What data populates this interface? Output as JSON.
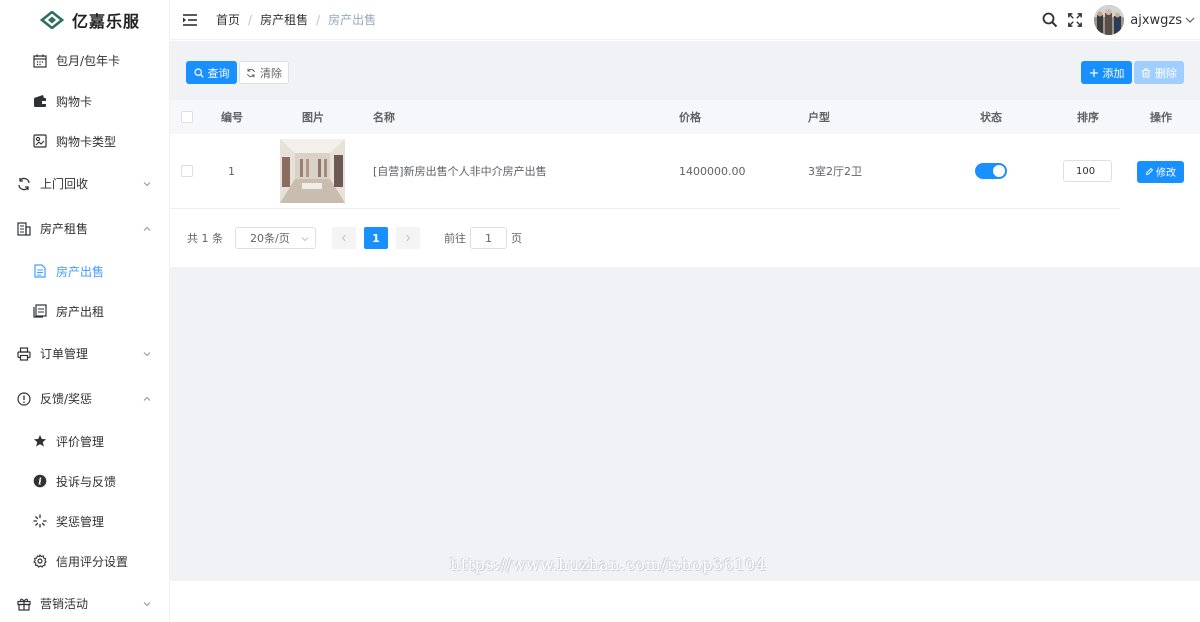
{
  "brand": {
    "name": "亿嘉乐服"
  },
  "sidebar": {
    "items": [
      {
        "label": "包月/包年卡",
        "level": "sub",
        "icon": "calendar-icon"
      },
      {
        "label": "购物卡",
        "level": "sub",
        "icon": "wallet-icon"
      },
      {
        "label": "购物卡类型",
        "level": "sub",
        "icon": "card-type-icon"
      },
      {
        "label": "上门回收",
        "level": "top",
        "icon": "refresh-icon",
        "expanded": false
      },
      {
        "label": "房产租售",
        "level": "top",
        "icon": "building-icon",
        "expanded": true
      },
      {
        "label": "房产出售",
        "level": "sub",
        "icon": "document-icon",
        "active": true
      },
      {
        "label": "房产出租",
        "level": "sub",
        "icon": "copy-icon"
      },
      {
        "label": "订单管理",
        "level": "top",
        "icon": "printer-icon",
        "expanded": false
      },
      {
        "label": "反馈/奖惩",
        "level": "top",
        "icon": "info-circle-icon",
        "expanded": true
      },
      {
        "label": "评价管理",
        "level": "sub",
        "icon": "star-icon"
      },
      {
        "label": "投诉与反馈",
        "level": "sub",
        "icon": "info-filled-icon"
      },
      {
        "label": "奖惩管理",
        "level": "sub",
        "icon": "loading-icon"
      },
      {
        "label": "信用评分设置",
        "level": "sub",
        "icon": "gear-icon"
      },
      {
        "label": "营销活动",
        "level": "top",
        "icon": "gift-icon",
        "expanded": false
      }
    ]
  },
  "header": {
    "breadcrumb": [
      "首页",
      "房产租售",
      "房产出售"
    ],
    "username": "ajxwgzs"
  },
  "toolbar": {
    "query_label": "查询",
    "clear_label": "清除",
    "add_label": "添加",
    "delete_label": "删除"
  },
  "table": {
    "columns": [
      "编号",
      "图片",
      "名称",
      "价格",
      "户型",
      "状态",
      "排序",
      "操作"
    ],
    "rows": [
      {
        "id": "1",
        "name": "[自营]新房出售个人非中介房产出售",
        "price": "1400000.00",
        "layout": "3室2厅2卫",
        "status_on": true,
        "sort": "100",
        "action": "修改"
      }
    ]
  },
  "pagination": {
    "total_text": "共 1 条",
    "page_size": "20条/页",
    "current_page": "1",
    "goto_prefix": "前往",
    "goto_value": "1",
    "goto_suffix": "页"
  },
  "watermark": "https://www.huzhan.com/ishop36104",
  "colors": {
    "primary": "#1890ff",
    "primary_disabled": "#a0cfff",
    "bg": "#f0f2f5",
    "active_menu": "#409eff"
  }
}
